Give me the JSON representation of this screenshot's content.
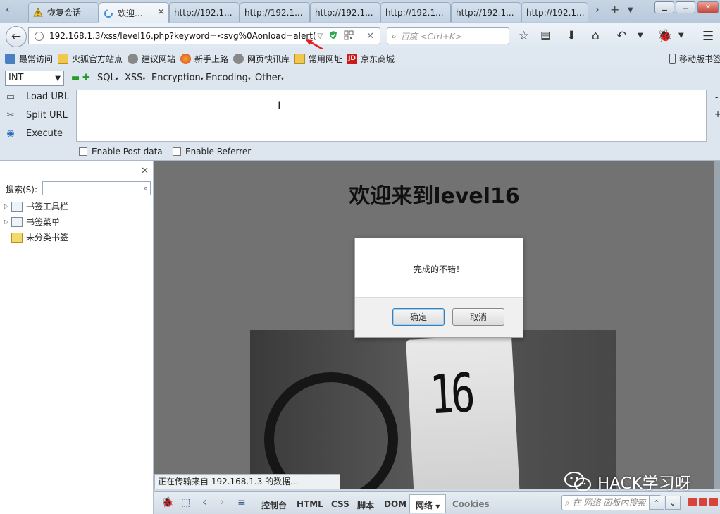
{
  "tabs": [
    {
      "label": "恢复会话",
      "active": false
    },
    {
      "label": "欢迎...",
      "active": true
    },
    {
      "label": "http://192.1...",
      "active": false
    },
    {
      "label": "http://192.1...",
      "active": false
    },
    {
      "label": "http://192.1...",
      "active": false
    },
    {
      "label": "http://192.1...",
      "active": false
    },
    {
      "label": "http://192.1...",
      "active": false
    },
    {
      "label": "http://192.1...",
      "active": false
    }
  ],
  "navbar": {
    "url": "192.168.1.3/xss/level16.php?keyword=<svg%0Aonload=alert(1",
    "search_placeholder": "百度 <Ctrl+K>"
  },
  "bookmarks": [
    {
      "label": "最常访问"
    },
    {
      "label": "火狐官方站点"
    },
    {
      "label": "建议网站"
    },
    {
      "label": "新手上路"
    },
    {
      "label": "网页快讯库"
    },
    {
      "label": "常用网址"
    },
    {
      "label": "京东商城"
    },
    {
      "label": "移动版书签"
    }
  ],
  "hackbar": {
    "select_value": "INT",
    "menus": [
      "SQL",
      "XSS",
      "Encryption",
      "Encoding",
      "Other"
    ],
    "side": {
      "load": "Load URL",
      "split": "Split URL",
      "execute": "Execute"
    },
    "textarea_value": "",
    "enable_post": "Enable Post data",
    "enable_referrer": "Enable Referrer"
  },
  "sidebar": {
    "search_label": "搜索(S):",
    "search_value": "",
    "items": [
      {
        "label": "书签工具栏"
      },
      {
        "label": "书签菜单"
      },
      {
        "label": "未分类书签"
      }
    ]
  },
  "page": {
    "heading": "欢迎来到level16",
    "image_number": "16"
  },
  "dialog": {
    "message": "完成的不错！",
    "ok": "确定",
    "cancel": "取消"
  },
  "status": {
    "text": "正在传输来自 192.168.1.3 的数据..."
  },
  "watermark": {
    "text": "HACK学习呀"
  },
  "devtools": {
    "tabs": [
      "控制台",
      "HTML",
      "CSS",
      "脚本",
      "DOM",
      "网络",
      "Cookies"
    ],
    "active_tab": "网络",
    "search_placeholder": "在 网络 面板内搜索"
  },
  "colors": {
    "chrome_bg": "#dfe7f0",
    "content_overlay": "#727272",
    "jd_red": "#cc1a1a",
    "shield_green": "#2fa84f"
  }
}
